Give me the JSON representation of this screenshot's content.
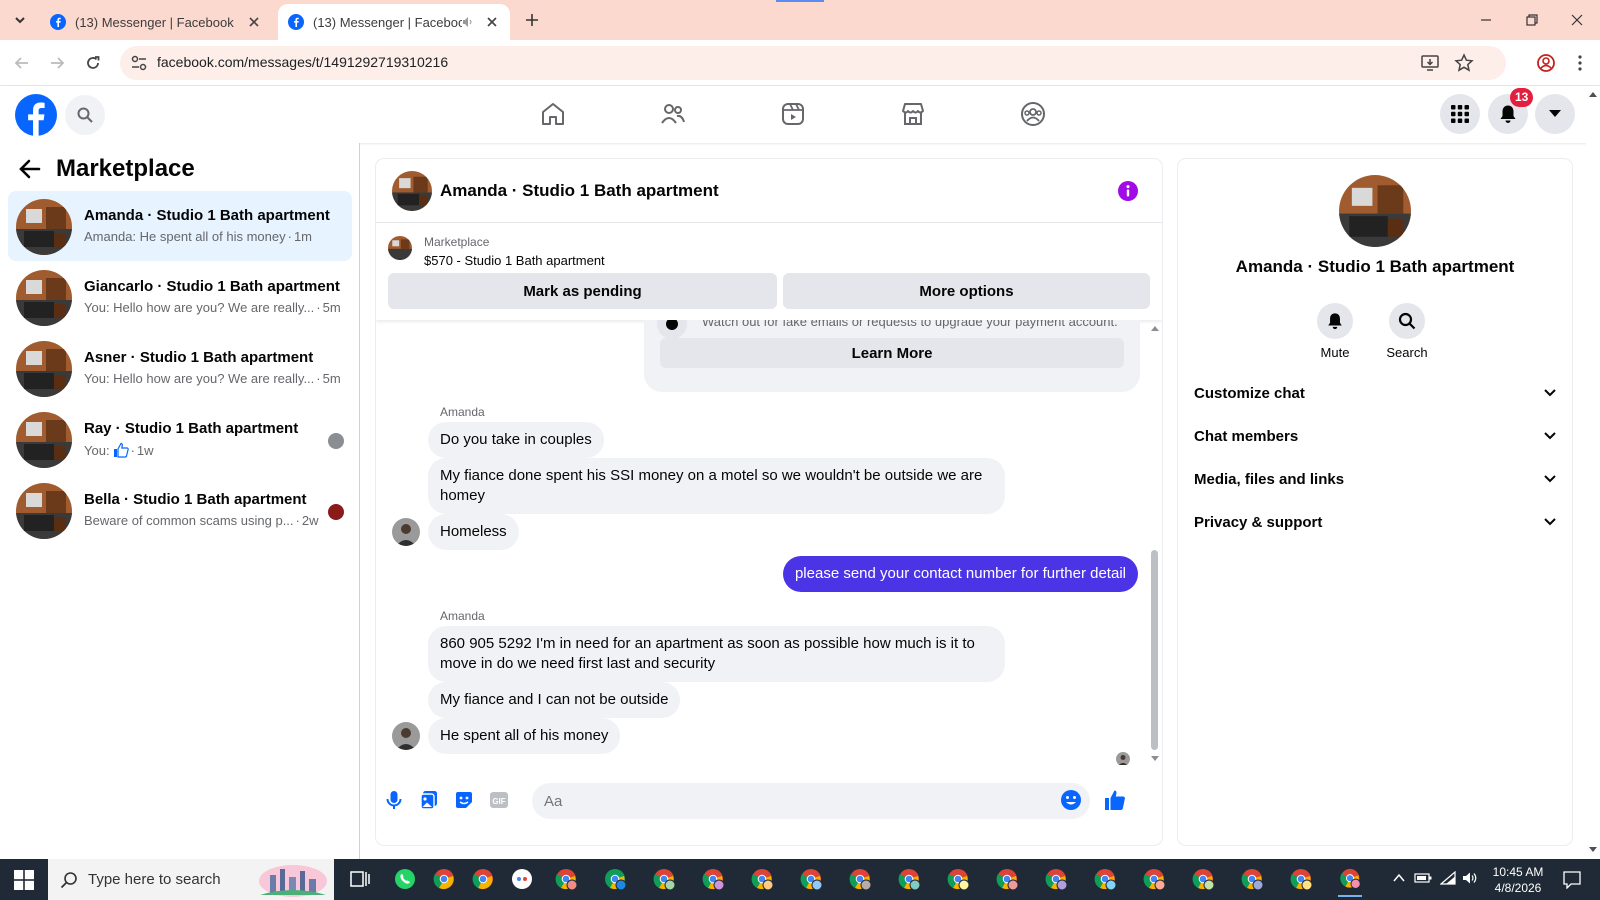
{
  "browser": {
    "tabs": [
      {
        "title": "(13) Messenger | Facebook"
      },
      {
        "title": "(13) Messenger | Facebook"
      }
    ],
    "url": "facebook.com/messages/t/1491292719310216"
  },
  "fb": {
    "notification_count": "13"
  },
  "sidebar": {
    "title": "Marketplace",
    "conversations": [
      {
        "name": "Amanda · Studio 1 Bath apartment",
        "preview": "Amanda: He spent all of his money",
        "time": "1m"
      },
      {
        "name": "Giancarlo · Studio 1 Bath apartment",
        "preview": "You: Hello how are you? We are really...",
        "time": "5m"
      },
      {
        "name": "Asner · Studio 1 Bath apartment",
        "preview": "You: Hello how are you? We are really...",
        "time": "5m"
      },
      {
        "name": "Ray · Studio 1 Bath apartment",
        "preview": "You:",
        "time": "1w"
      },
      {
        "name": "Bella · Studio 1 Bath apartment",
        "preview": "Beware of common scams using p...",
        "time": "2w"
      }
    ]
  },
  "chat": {
    "title": "Amanda · Studio 1 Bath apartment",
    "listing": {
      "category": "Marketplace",
      "title": "$570 - Studio 1 Bath apartment",
      "mark_pending": "Mark as pending",
      "more_options": "More options"
    },
    "scam_notice": {
      "text": "Watch out for fake emails or requests to upgrade your payment account.",
      "learn_more": "Learn More"
    },
    "sender_name": "Amanda",
    "messages": [
      "Do you take in couples",
      "My fiance done spent his SSI money on a motel so we wouldn't be outside we are homey",
      "Homeless",
      "please send your contact number for further detail",
      "860 905 5292 I'm in need for an apartment as soon as possible how much is it to move in do we need first last and security",
      "My fiance and I can not be outside",
      "He spent all of his money"
    ],
    "composer_placeholder": "Aa"
  },
  "info_panel": {
    "name": "Amanda · Studio 1 Bath apartment",
    "actions": {
      "mute": "Mute",
      "search": "Search"
    },
    "sections": [
      "Customize chat",
      "Chat members",
      "Media, files and links",
      "Privacy & support"
    ]
  },
  "taskbar": {
    "search_placeholder": "Type here to search",
    "time": "10:45 AM",
    "date": "4/8/2026"
  },
  "colors": {
    "fb_blue": "#0866ff",
    "outgoing_bubble": "#4b34e6",
    "badge_red": "#e41e3f",
    "tab_strip": "#fcd9cf"
  }
}
